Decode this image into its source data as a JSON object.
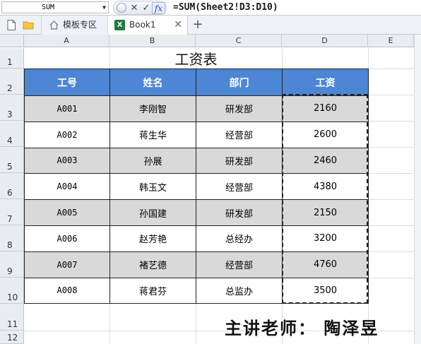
{
  "formula_bar": {
    "name_box": "SUM",
    "formula": "=SUM(Sheet2!D3:D10)"
  },
  "tabs": {
    "templates_label": "模板专区",
    "book_label": "Book1"
  },
  "icons": {
    "new_file": "new-file-icon",
    "folder": "folder-icon",
    "home": "home-icon",
    "excel": "excel-icon",
    "close": "close-icon",
    "add": "plus-icon",
    "cancel": "cancel-icon",
    "accept": "check-icon",
    "function": "fx-icon"
  },
  "columns": [
    "A",
    "B",
    "C",
    "D",
    "E"
  ],
  "rows": [
    "1",
    "2",
    "3",
    "4",
    "5",
    "6",
    "7",
    "8",
    "9",
    "10",
    "11",
    "12"
  ],
  "sheet": {
    "title": "工资表",
    "headers": [
      "工号",
      "姓名",
      "部门",
      "工资"
    ],
    "records": [
      [
        "A001",
        "李刚智",
        "研发部",
        "2160"
      ],
      [
        "A002",
        "蒋生华",
        "经营部",
        "2600"
      ],
      [
        "A003",
        "孙展",
        "研发部",
        "2460"
      ],
      [
        "A004",
        "韩玉文",
        "经营部",
        "4380"
      ],
      [
        "A005",
        "孙国建",
        "研发部",
        "2150"
      ],
      [
        "A006",
        "赵芳艳",
        "总经办",
        "3200"
      ],
      [
        "A007",
        "褚艺德",
        "经营部",
        "4760"
      ],
      [
        "A008",
        "蒋君芬",
        "总监办",
        "3500"
      ]
    ]
  },
  "presenter": "主讲老师： 陶泽昱",
  "colors": {
    "header_fill": "#4d86d4",
    "band_fill": "#d9d9d9",
    "fx_accent": "#2a4fa8"
  }
}
